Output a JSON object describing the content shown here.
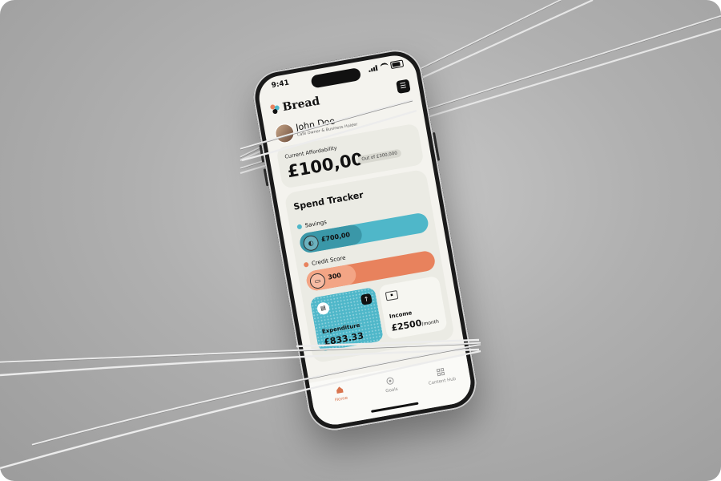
{
  "status": {
    "time": "9:41"
  },
  "app": {
    "brand": "Bread"
  },
  "user": {
    "name": "John Doe",
    "role": "Cafe Owner & Business Holder"
  },
  "affordability": {
    "label": "Current Affordability",
    "value": "£100,00",
    "out_of": "Out of £300,000"
  },
  "tracker": {
    "title": "Spend Tracker",
    "savings": {
      "label": "Savings",
      "value": "£700,00",
      "fill_fraction": 0.48,
      "color": "#4fb7c9"
    },
    "credit": {
      "label": "Credit Score",
      "value": "300",
      "fill_fraction": 0.38,
      "color": "#e8825d"
    }
  },
  "cards": {
    "expenditure": {
      "label": "Expenditure",
      "value": "£833.33"
    },
    "income": {
      "label": "Income",
      "value": "£2500",
      "unit": "/month"
    }
  },
  "tabs": [
    {
      "label": "Home",
      "icon": "home-icon",
      "active": true
    },
    {
      "label": "Goals",
      "icon": "target-icon",
      "active": false
    },
    {
      "label": "Content Hub",
      "icon": "grid-icon",
      "active": false
    }
  ],
  "colors": {
    "accent_teal": "#4fb7c9",
    "accent_orange": "#e8825d",
    "background": "#b0b0b0"
  }
}
